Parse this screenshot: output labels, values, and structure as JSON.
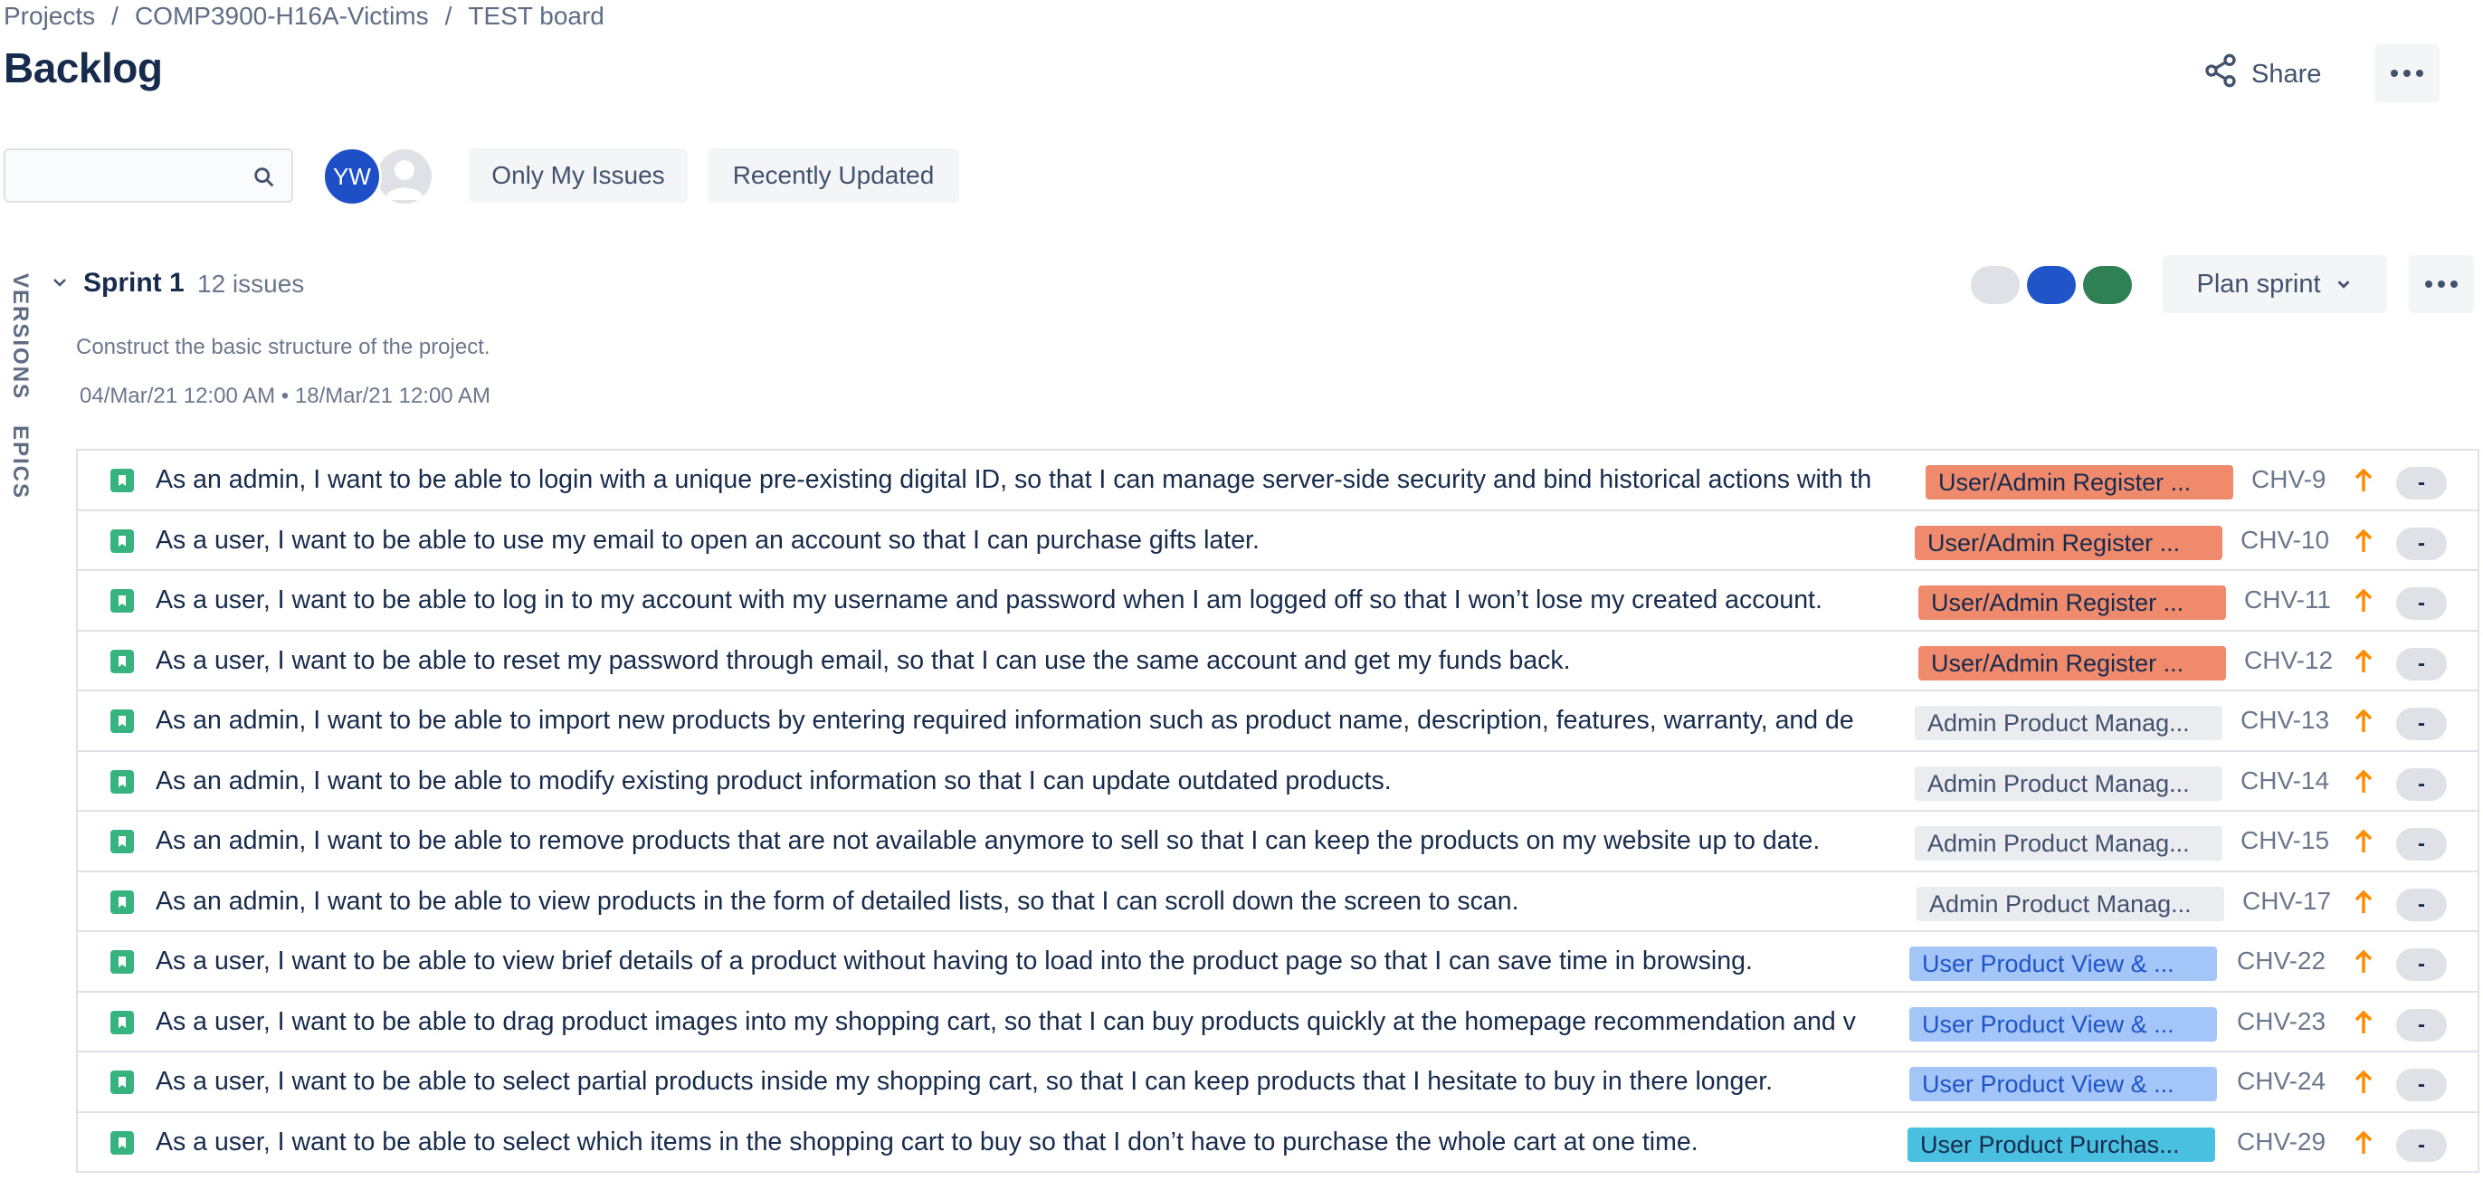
{
  "breadcrumb": {
    "items": [
      "Projects",
      "COMP3900-H16A-Victims",
      "TEST board"
    ],
    "separator": "/"
  },
  "header": {
    "title": "Backlog",
    "share_label": "Share"
  },
  "toolbar": {
    "search_value": "",
    "avatar_initials": "YW",
    "filters": [
      "Only My Issues",
      "Recently Updated"
    ]
  },
  "side_tabs": {
    "versions": "VERSIONS",
    "epics": "EPICS"
  },
  "sprint": {
    "name": "Sprint 1",
    "count": "12 issues",
    "goal": "Construct the basic structure of the project.",
    "dates": "04/Mar/21 12:00 AM  •  18/Mar/21 12:00 AM",
    "plan_label": "Plan sprint"
  },
  "colors": {
    "story": "#36b37e",
    "priority": "#ff8b00",
    "status_todo": "#dfe1e6",
    "status_in_progress": "#1f55c9",
    "status_done": "#2f8055"
  },
  "issues": [
    {
      "summary": "As an admin, I want to be able to login with a unique pre-existing digital ID, so that I can manage server-side security and bind historical actions with th",
      "epic": "User/Admin Register ...",
      "key": "CHV-9",
      "estimate": "-"
    },
    {
      "summary": "As a user, I want to be able to use my email to open an account so that I can purchase gifts later.",
      "epic": "User/Admin Register ...",
      "key": "CHV-10",
      "estimate": "-"
    },
    {
      "summary": "As a user, I want to be able to log in to my account with my username and password when I am logged off so that I won’t lose my created account.",
      "epic": "User/Admin Register ...",
      "key": "CHV-11",
      "estimate": "-"
    },
    {
      "summary": "As a user, I want to be able to reset my password through email, so that I can use the same account and get my funds back.",
      "epic": "User/Admin Register ...",
      "key": "CHV-12",
      "estimate": "-"
    },
    {
      "summary": "As an admin, I want to be able to import new products by entering required information such as product name, description, features, warranty, and de",
      "epic": "Admin Product Manag...",
      "key": "CHV-13",
      "estimate": "-"
    },
    {
      "summary": "As an admin, I want to be able to modify existing product information so that I can update outdated products.",
      "epic": "Admin Product Manag...",
      "key": "CHV-14",
      "estimate": "-"
    },
    {
      "summary": "As an admin, I want to be able to remove products that are not available anymore to sell so that I can keep the products on my website up to date.",
      "epic": "Admin Product Manag...",
      "key": "CHV-15",
      "estimate": "-"
    },
    {
      "summary": "As an admin, I want to be able to view products in the form of detailed lists, so that I can scroll down the screen to scan.",
      "epic": "Admin Product Manag...",
      "key": "CHV-17",
      "estimate": "-"
    },
    {
      "summary": "As a user, I want to be able to view brief details of a product without having to load into the product page so that I can save time in browsing.",
      "epic": "User Product View & ...",
      "key": "CHV-22",
      "estimate": "-"
    },
    {
      "summary": "As a user, I want to be able to drag product images into my shopping cart, so that I can buy products quickly at the homepage recommendation and v",
      "epic": "User Product View & ...",
      "key": "CHV-23",
      "estimate": "-"
    },
    {
      "summary": "As a user, I want to be able to select partial products inside my shopping cart, so that I can keep products that I hesitate to buy in there longer.",
      "epic": "User Product View & ...",
      "key": "CHV-24",
      "estimate": "-"
    },
    {
      "summary": "As a user, I want to be able to select which items in the shopping cart to buy so that I don’t have to purchase the whole cart at one time.",
      "epic": "User Product Purchas...",
      "key": "CHV-29",
      "estimate": "-"
    }
  ]
}
